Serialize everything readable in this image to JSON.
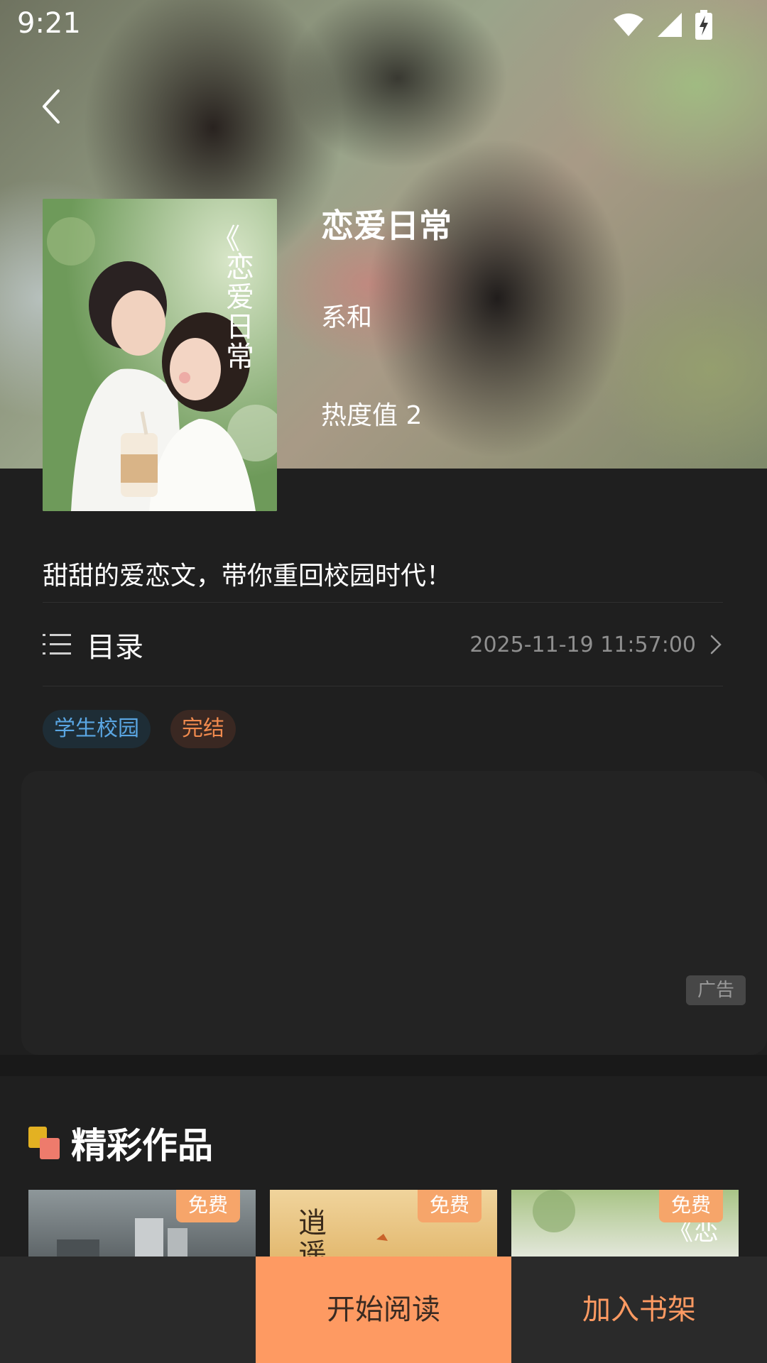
{
  "status_bar": {
    "time": "9:21",
    "icons": [
      "wifi-icon",
      "signal-icon",
      "battery-charging-icon"
    ]
  },
  "header": {
    "back_icon": "chevron-left-icon"
  },
  "book": {
    "cover_title_text": "《恋爱日常",
    "title": "恋爱日常",
    "author": "系和",
    "heat": "热度值 2",
    "description": "甜甜的爱恋文，带你重回校园时代！"
  },
  "toc": {
    "icon": "list-icon",
    "label": "目录",
    "updated": "2025-11-19 11:57:00",
    "arrow_icon": "chevron-right-icon"
  },
  "tags": [
    {
      "label": "学生校园",
      "color": "#5aa6e3"
    },
    {
      "label": "完结",
      "color": "#f08a4e"
    }
  ],
  "ad": {
    "badge": "广告"
  },
  "featured": {
    "title": "精彩作品",
    "items": [
      {
        "badge": "免费"
      },
      {
        "badge": "免费"
      },
      {
        "badge": "免费"
      }
    ]
  },
  "bottom_bar": {
    "read_label": "开始阅读",
    "shelf_label": "加入书架"
  },
  "colors": {
    "accent": "#fe9a62",
    "background": "#1f1f1f"
  }
}
